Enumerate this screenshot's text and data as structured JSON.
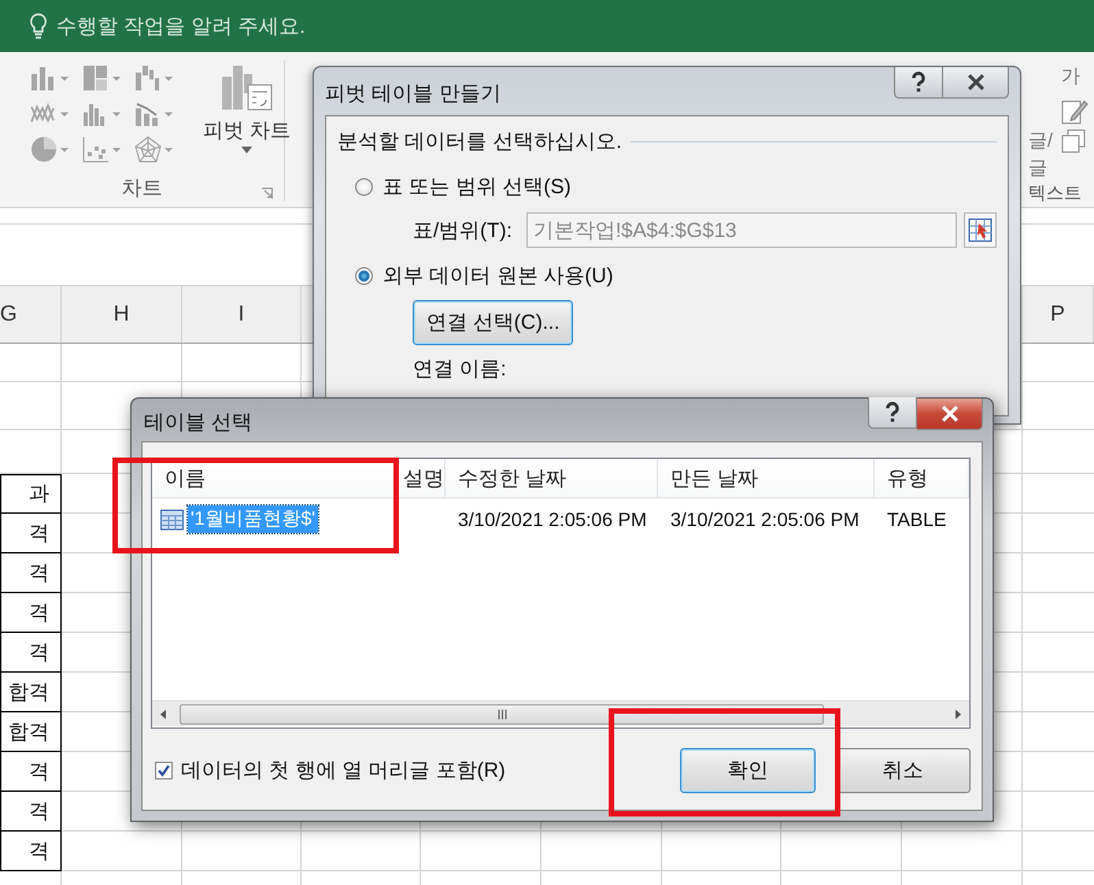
{
  "tell_me": {
    "placeholder": "수행할 작업을 알려 주세요."
  },
  "ribbon": {
    "pivot_chart": "피벗 차트",
    "chart_group": "차트",
    "text_group": {
      "top_label": "가",
      "items": [
        "글/",
        "글"
      ],
      "label": "텍스트"
    }
  },
  "sheet": {
    "columns_left": [
      "G",
      "H",
      "I"
    ],
    "column_right": "P",
    "column_g_cells": [
      "과",
      "격",
      "격",
      "격",
      "격",
      "합격",
      "합격",
      "격",
      "격",
      "격"
    ]
  },
  "pivot_dialog": {
    "title": "피벗 테이블 만들기",
    "section": "분석할 데이터를 선택하십시오.",
    "options": [
      {
        "label": "표 또는 범위 선택(S)",
        "selected": false
      },
      {
        "label": "외부 데이터 원본 사용(U)",
        "selected": true
      }
    ],
    "range": {
      "label": "표/범위(T):",
      "value": "기본작업!$A$4:$G$13",
      "disabled": true
    },
    "connection_button": "연결 선택(C)...",
    "connection_name": "연결 이름:"
  },
  "table_dialog": {
    "title": "테이블 선택",
    "columns": [
      "이름",
      "설명",
      "수정한 날짜",
      "만든 날짜",
      "유형"
    ],
    "rows": [
      {
        "name": "'1월비품현황$'",
        "modified": "3/10/2021 2:05:06 PM",
        "created": "3/10/2021 2:05:06 PM",
        "type": "TABLE",
        "selected": true
      }
    ],
    "header_checkbox": {
      "label": "데이터의 첫 행에 열 머리글 포함(R)",
      "checked": true
    },
    "buttons": [
      {
        "label": "확인",
        "default": true
      },
      {
        "label": "취소",
        "default": false
      }
    ]
  }
}
